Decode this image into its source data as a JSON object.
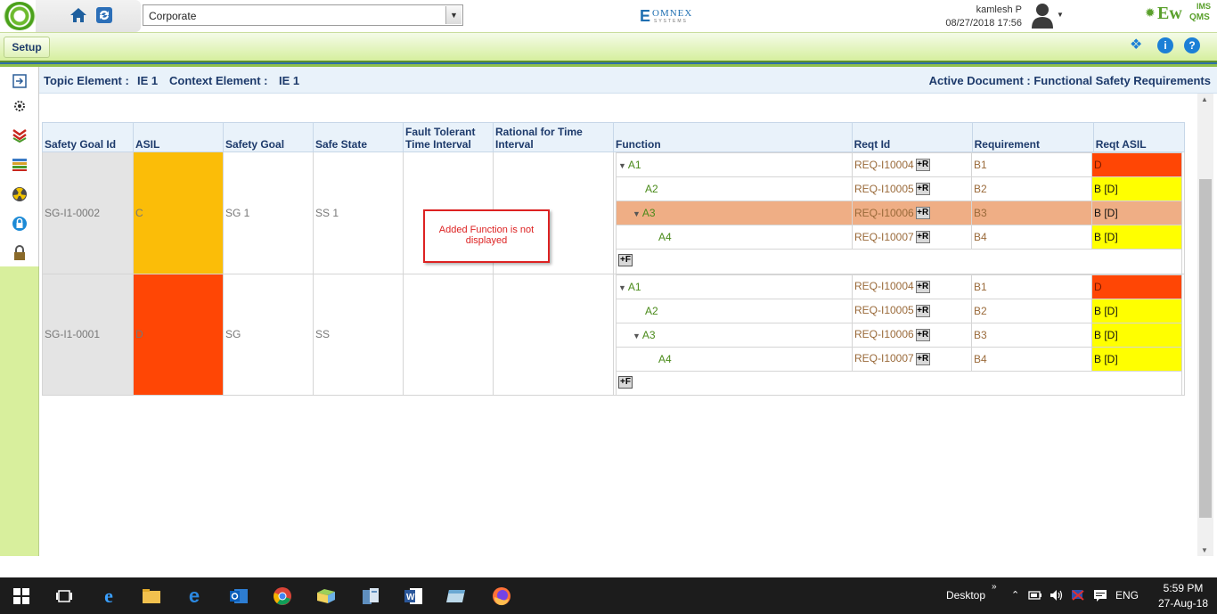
{
  "header": {
    "org_select_value": "Corporate",
    "brand_omnex_letter": "E",
    "brand_omnex_name": "OMNEX",
    "brand_omnex_sub": "SYSTEMS",
    "user_name": "kamlesh P",
    "user_datetime": "08/27/2018 17:56",
    "product_ew": "Ew",
    "product_ims": "IMS",
    "product_q": "QMS"
  },
  "setup": {
    "tab_label": "Setup",
    "info_glyph": "i",
    "help_glyph": "?"
  },
  "context": {
    "topic_label": "Topic Element :",
    "topic_value": "IE 1",
    "context_label": "Context Element :",
    "context_value": "IE 1",
    "active_doc": "Active Document : Functional Safety Requirements"
  },
  "table": {
    "headers": {
      "sg_id": "Safety Goal Id",
      "asil": "ASIL",
      "safety_goal": "Safety Goal",
      "safe_state": "Safe State",
      "ftti": "Fault Tolerant Time Interval",
      "rational": "Rational for Time Interval",
      "function": "Function",
      "reqt_id": "Reqt Id",
      "requirement": "Requirement",
      "reqt_asil": "Reqt ASIL"
    },
    "rows": [
      {
        "sg_id": "SG-I1-0002",
        "asil": "C",
        "safety_goal": "SG 1",
        "safe_state": "SS 1",
        "functions": [
          {
            "name": "A1",
            "reqt_id": "REQ-I10004",
            "requirement": "B1",
            "reqt_asil": "D"
          },
          {
            "name": "A2",
            "reqt_id": "REQ-I10005",
            "requirement": "B2",
            "reqt_asil": "B [D]"
          },
          {
            "name": "A3",
            "reqt_id": "REQ-I10006",
            "requirement": "B3",
            "reqt_asil": "B [D]"
          },
          {
            "name": "A4",
            "reqt_id": "REQ-I10007",
            "requirement": "B4",
            "reqt_asil": "B [D]"
          }
        ]
      },
      {
        "sg_id": "SG-I1-0001",
        "asil": "D",
        "safety_goal": "SG",
        "safe_state": "SS",
        "functions": [
          {
            "name": "A1",
            "reqt_id": "REQ-I10004",
            "requirement": "B1",
            "reqt_asil": "D"
          },
          {
            "name": "A2",
            "reqt_id": "REQ-I10005",
            "requirement": "B2",
            "reqt_asil": "B [D]"
          },
          {
            "name": "A3",
            "reqt_id": "REQ-I10006",
            "requirement": "B3",
            "reqt_asil": "B [D]"
          },
          {
            "name": "A4",
            "reqt_id": "REQ-I10007",
            "requirement": "B4",
            "reqt_asil": "B [D]"
          }
        ]
      }
    ],
    "add_req_label": "+R",
    "add_func_label": "+F"
  },
  "annotation": {
    "text": "Added Function is not displayed"
  },
  "taskbar": {
    "desktop_label": "Desktop",
    "language": "ENG",
    "time": "5:59 PM",
    "date": "27-Aug-18"
  },
  "colors": {
    "asil_c": "#fbbd08",
    "asil_d": "#ff4605",
    "asil_b": "#ffff00",
    "selected_row": "#efae85"
  }
}
